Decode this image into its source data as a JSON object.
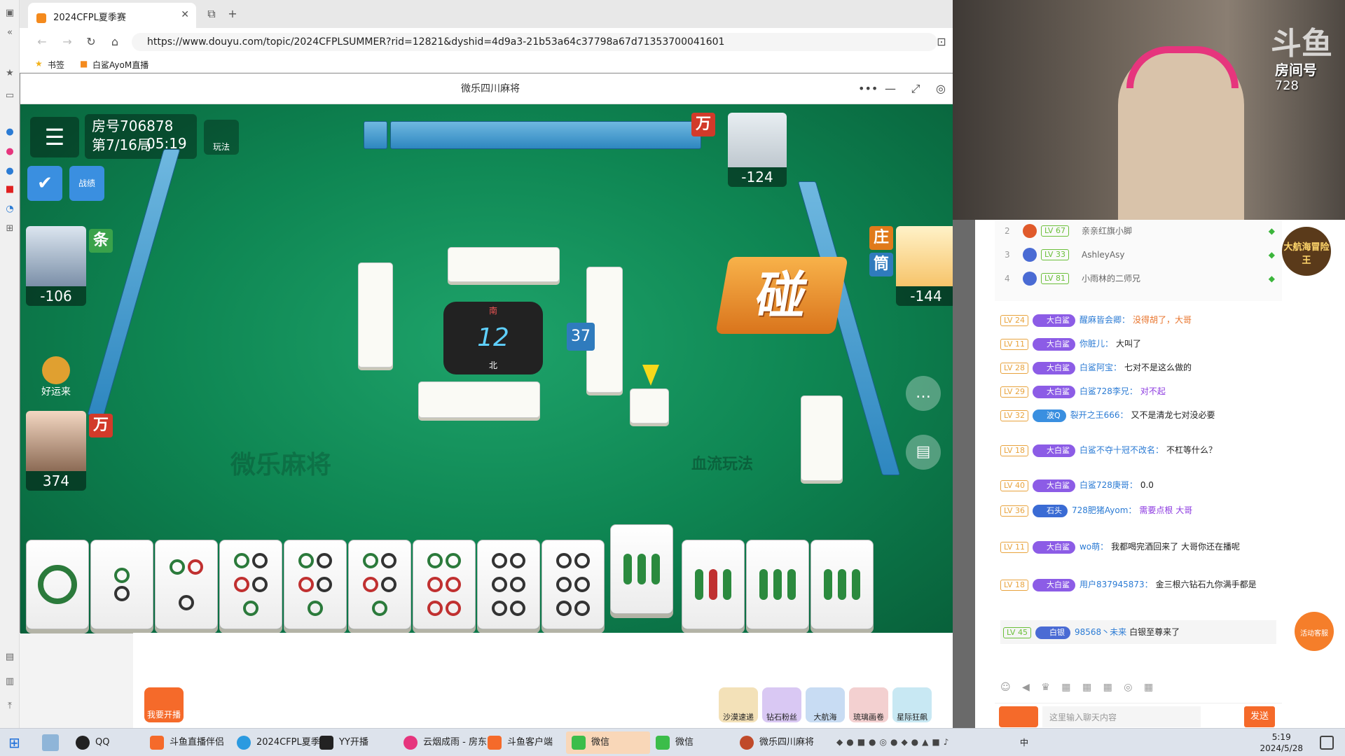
{
  "browser": {
    "tab_title": "2024CFPL夏季赛",
    "url": "https://www.douyu.com/topic/2024CFPLSUMMER?rid=12821&dyshid=4d9a3-21b53a64c37798a67d71353700041601",
    "bookmarks": [
      "书签",
      "白鲨AyoM直播"
    ]
  },
  "game": {
    "window_title": "微乐四川麻将",
    "room_label": "房号706878",
    "round_label": "第7/16局",
    "clock": "05:19",
    "rules_btn": "玩法",
    "record_btn": "战绩",
    "luck_label": "好运来",
    "remaining_tiles": "37",
    "dice_number": "12",
    "wind_south": "南",
    "wind_north": "北",
    "action_text": "碰",
    "watermark": "微乐麻将",
    "mode_label": "血流玩法",
    "players": {
      "top": {
        "score": "-124",
        "suit": "万"
      },
      "left": {
        "score": "-106",
        "suit": "条"
      },
      "right": {
        "score": "-144",
        "suit": "筒",
        "dealer": "庄"
      },
      "self": {
        "score": "374",
        "suit": "万"
      }
    }
  },
  "stream": {
    "logo": "斗鱼",
    "room_label": "房间号",
    "room_id": "728"
  },
  "rank": [
    {
      "num": "2",
      "lv": "LV 67",
      "name": "亲亲红旗小脚"
    },
    {
      "num": "3",
      "lv": "LV 33",
      "name": "AshleyAsy"
    },
    {
      "num": "4",
      "lv": "LV 81",
      "name": "小雨林的二师兄"
    }
  ],
  "chat": [
    {
      "lv": "LV 24",
      "fan": "大白鲨",
      "user": "醒麻皆会卿：",
      "text": "没得胡了，大哥"
    },
    {
      "lv": "LV 11",
      "fan": "大白鲨",
      "user": "你脏儿：",
      "text": "大叫了"
    },
    {
      "lv": "LV 28",
      "fan": "大白鲨",
      "user": "白鲨阿宝：",
      "text": "七对不是这么做的"
    },
    {
      "lv": "LV 29",
      "fan": "大白鲨",
      "user": "白鲨728李兄：",
      "text": "对不起"
    },
    {
      "lv": "LV 32",
      "fan": "波Q",
      "user": "裂开之王666：",
      "text": "又不是清龙七对没必要"
    },
    {
      "lv": "LV 18",
      "fan": "大白鲨",
      "user": "白鲨不夺十冠不改名：",
      "text": "不杠等什么？"
    },
    {
      "lv": "LV 40",
      "fan": "大白鲨",
      "user": "白鲨728庚哥：",
      "text": "0.0"
    },
    {
      "lv": "LV 36",
      "fan": "石头",
      "user": "728肥猪Ayom：",
      "text": "需要点根 大哥"
    },
    {
      "lv": "LV 11",
      "fan": "大白鲨",
      "user": "wo萌：",
      "text": "我都喝完酒回来了 大哥你还在播呢"
    },
    {
      "lv": "LV 18",
      "fan": "大白鲨",
      "user": "用户837945873：",
      "text": "金三根六钻石九你满手都是"
    },
    {
      "lv": "LV 45",
      "fan": "白银",
      "user": "98568丶未来",
      "text": "白银至尊来了"
    }
  ],
  "chat_input": {
    "placeholder": "这里输入聊天内容",
    "send": "发送"
  },
  "adventure": "大航海冒险王",
  "support": "活动客服",
  "mini_bar": [
    "我要开播",
    "沙漠速递",
    "钻石粉丝",
    "大航海",
    "琉璃画卷",
    "星际狂飙"
  ],
  "taskbar": {
    "items": [
      "QQ",
      "斗鱼直播伴侣",
      "2024CFPL夏季赛",
      "YY开播",
      "云烟成雨 - 房东...",
      "斗鱼客户端",
      "微信",
      "微信",
      "微乐四川麻将"
    ],
    "time": "5:19",
    "date": "2024/5/28",
    "ime": "中"
  },
  "colors": {
    "accent": "#f56a2a",
    "felt": "#0e8552",
    "tile_blue": "#2e87c0"
  }
}
